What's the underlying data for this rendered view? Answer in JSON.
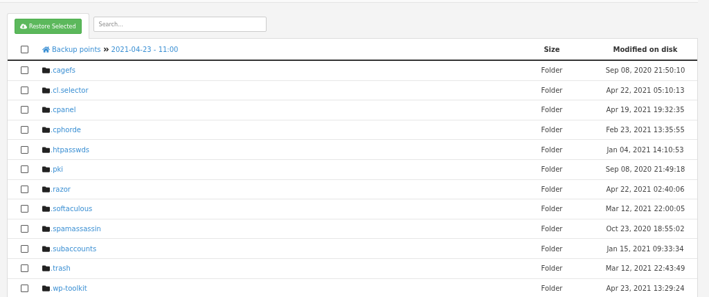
{
  "toolbar": {
    "restore_button": "Restore Selected",
    "search": {
      "placeholder": "Search..."
    }
  },
  "table": {
    "select_all": {
      "checked": false
    },
    "breadcrumb": [
      "Backup points",
      "2021-04-23 - 11:00"
    ],
    "columns": [
      "Size",
      "Modified on disk"
    ],
    "rows": [
      {
        "name": ".cagefs",
        "size": "Folder",
        "modified": "Sep 08, 2020 21:50:10",
        "checked": false
      },
      {
        "name": ".cl.selector",
        "size": "Folder",
        "modified": "Apr 22, 2021 05:10:13",
        "checked": false
      },
      {
        "name": ".cpanel",
        "size": "Folder",
        "modified": "Apr 19, 2021 19:32:35",
        "checked": false
      },
      {
        "name": ".cphorde",
        "size": "Folder",
        "modified": "Feb 23, 2021 13:35:55",
        "checked": false
      },
      {
        "name": ".htpasswds",
        "size": "Folder",
        "modified": "Jan 04, 2021 14:10:53",
        "checked": false
      },
      {
        "name": ".pki",
        "size": "Folder",
        "modified": "Sep 08, 2020 21:49:18",
        "checked": false
      },
      {
        "name": ".razor",
        "size": "Folder",
        "modified": "Apr 22, 2021 02:40:06",
        "checked": false
      },
      {
        "name": ".softaculous",
        "size": "Folder",
        "modified": "Mar 12, 2021 22:00:05",
        "checked": false
      },
      {
        "name": ".spamassassin",
        "size": "Folder",
        "modified": "Oct 23, 2020 18:55:02",
        "checked": false
      },
      {
        "name": ".subaccounts",
        "size": "Folder",
        "modified": "Jan 15, 2021 09:33:34",
        "checked": false
      },
      {
        "name": ".trash",
        "size": "Folder",
        "modified": "Mar 12, 2021 22:43:49",
        "checked": false
      },
      {
        "name": ".wp-toolkit",
        "size": "Folder",
        "modified": "Apr 23, 2021 13:29:24",
        "checked": false
      }
    ]
  }
}
